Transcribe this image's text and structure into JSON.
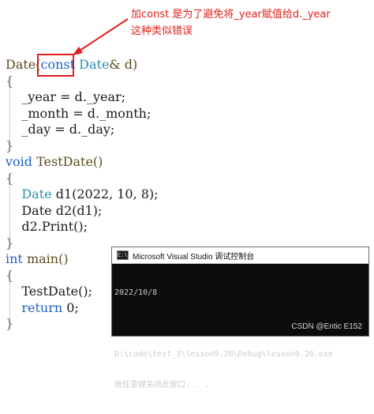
{
  "annotation": {
    "line1": "加const 是为了避免将_year赋值给d._year",
    "line2": "这种类似错误"
  },
  "code": {
    "l1_a": "Date(",
    "l1_b": "const",
    "l1_c": " Date",
    "l1_d": "& d)",
    "l2": "{",
    "l3": "    _year = d._year;",
    "l4": "    _month = d._month;",
    "l5": "    _day = d._day;",
    "l6": "}",
    "l7_kw": "void",
    "l7_rest": " TestDate()",
    "l8": "{",
    "l9_type": "    Date",
    "l9_rest": " d1(2022, 10, 8);",
    "l10": "    Date d2(d1);",
    "l11": "    d2.Print();",
    "l12": "}",
    "l13_kw": "int",
    "l13_rest": " main()",
    "l14": "{",
    "l15": "    TestDate();",
    "l16_kw": "    return",
    "l16_rest": " 0;",
    "l17": "}"
  },
  "console": {
    "icon_text": "C:\\",
    "title": "Microsoft Visual Studio 调试控制台",
    "output_line1": "2022/10/8",
    "output_line2": "",
    "output_line3": "D:\\code\\test_3\\lesson9.26\\Debug\\lesson9.26.exe",
    "output_line4": "按任意键关闭此窗口. . ."
  },
  "watermark": "CSDN @Entic E152",
  "colors": {
    "annotation_red": "#e0201b",
    "keyword_blue": "#1f5fc2",
    "type_teal": "#2b91af",
    "console_bg": "#0c0c0c"
  }
}
